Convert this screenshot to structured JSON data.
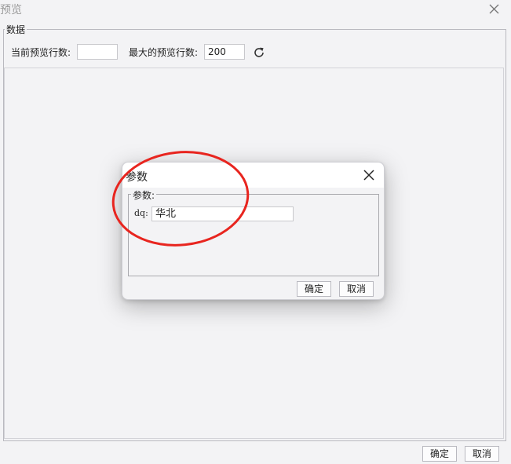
{
  "window": {
    "title": "预览"
  },
  "data_section": {
    "legend": "数据",
    "current_rows_label": "当前预览行数:",
    "current_rows_value": "",
    "max_rows_label": "最大的预览行数:",
    "max_rows_value": "200"
  },
  "footer": {
    "ok_label": "确定",
    "cancel_label": "取消"
  },
  "dialog": {
    "title": "参数",
    "legend": "参数:",
    "param_label": "dq:",
    "param_value": "华北",
    "ok_label": "确定",
    "cancel_label": "取消"
  },
  "colors": {
    "annotation": "#e8251f",
    "background": "#f3f3f5"
  }
}
